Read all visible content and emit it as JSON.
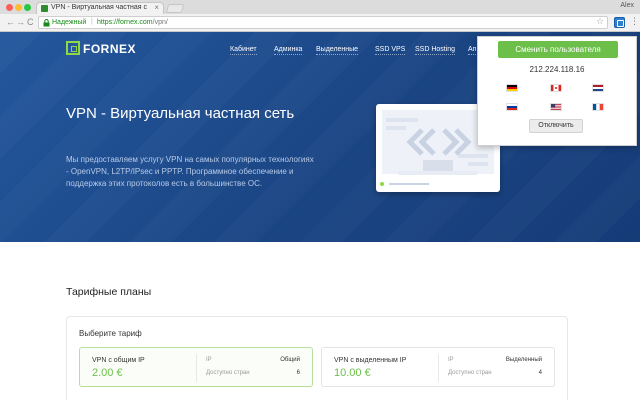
{
  "browser": {
    "tab_title": "VPN - Виртуальная частная с",
    "tab_close": "×",
    "profile_name": "Alex",
    "secure_label": "Надежный",
    "url_sep": "|",
    "url_scheme_host": "https://fornex.com",
    "url_path": "/vpn/",
    "back": "←",
    "forward": "→",
    "reload": "C",
    "star": "☆",
    "menu": "⋮"
  },
  "site": {
    "logo_text": "FORNEX",
    "nav": [
      "Кабинет",
      "Админка",
      "Выделенные",
      "SSD VPS",
      "SSD Hosting",
      "Ап"
    ]
  },
  "hero": {
    "title": "VPN - Виртуальная частная сеть",
    "text": "Мы предоставляем услугу VPN на самых популярных технологиях - OpenVPN, L2TP/IPsec и PPTP. Программное обеспечение и поддержка этих протоколов есть в большинстве ОС."
  },
  "popup": {
    "switch_button": "Сменить пользователя",
    "ip": "212.224.118.16",
    "flags": [
      "germany-flag",
      "canada-flag",
      "netherlands-flag",
      "russia-flag",
      "usa-flag",
      "france-flag"
    ],
    "disconnect_button": "Отключить"
  },
  "pricing": {
    "section_title": "Тарифные планы",
    "choose_label": "Выберите тариф",
    "plans": [
      {
        "name": "VPN с общим IP",
        "price": "2.00 €",
        "ip_label": "IP",
        "ip_value": "Общий",
        "countries_label": "Доступно стран",
        "countries_value": "6"
      },
      {
        "name": "VPN с выделенным IP",
        "price": "10.00 €",
        "ip_label": "IP",
        "ip_value": "Выделенный",
        "countries_label": "Доступно стран",
        "countries_value": "4"
      }
    ]
  },
  "colors": {
    "accent_green": "#6cc04a",
    "hero_blue": "#1a4583",
    "secure_green": "#1a8a1a"
  }
}
